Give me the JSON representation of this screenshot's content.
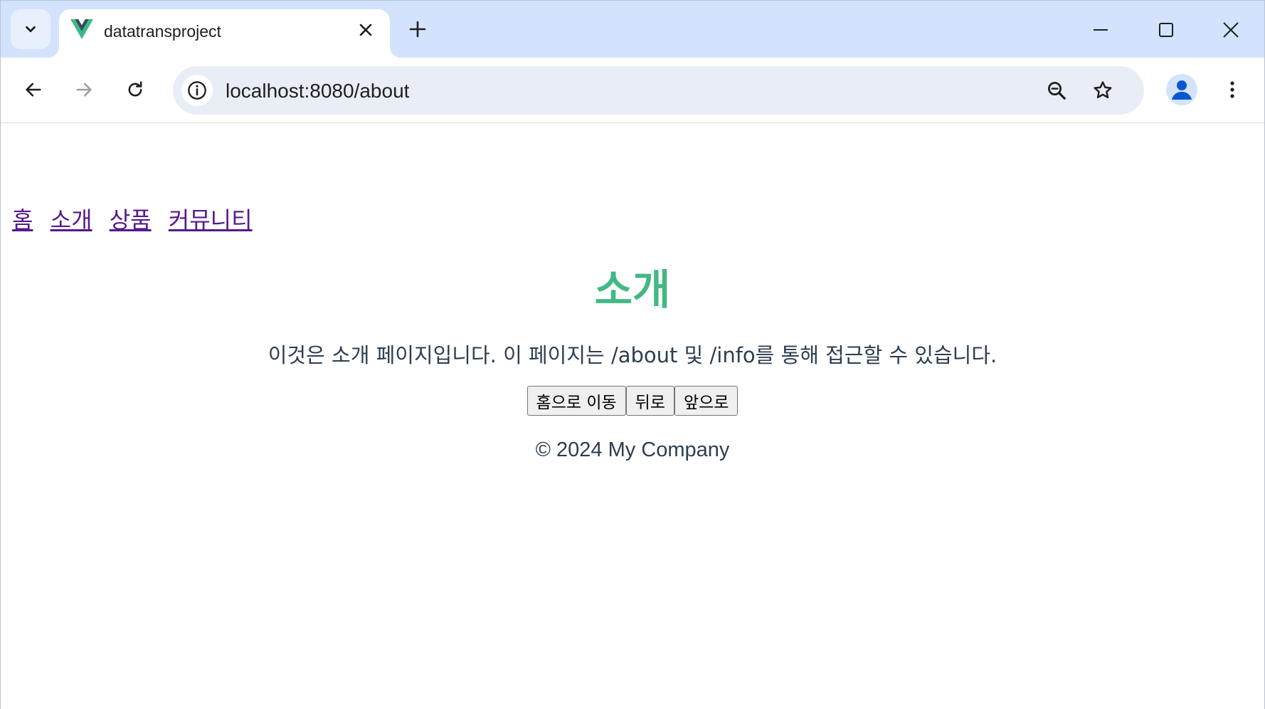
{
  "browser": {
    "tab_title": "datatransproject",
    "url": "localhost:8080/about",
    "favicon": "vue-logo-icon",
    "colors": {
      "tabstrip": "#d3e3fd",
      "omnibox": "#e9eef6"
    }
  },
  "page": {
    "nav": [
      "홈",
      "소개",
      "상품",
      "커뮤니티"
    ],
    "title": "소개",
    "description": "이것은 소개 페이지입니다. 이 페이지는 /about 및 /info를 통해 접근할 수 있습니다.",
    "buttons": [
      "홈으로 이동",
      "뒤로",
      "앞으로"
    ],
    "footer": "© 2024 My Company",
    "colors": {
      "title": "#42b983",
      "text": "#2c3e50",
      "link": "#551a8b"
    }
  }
}
